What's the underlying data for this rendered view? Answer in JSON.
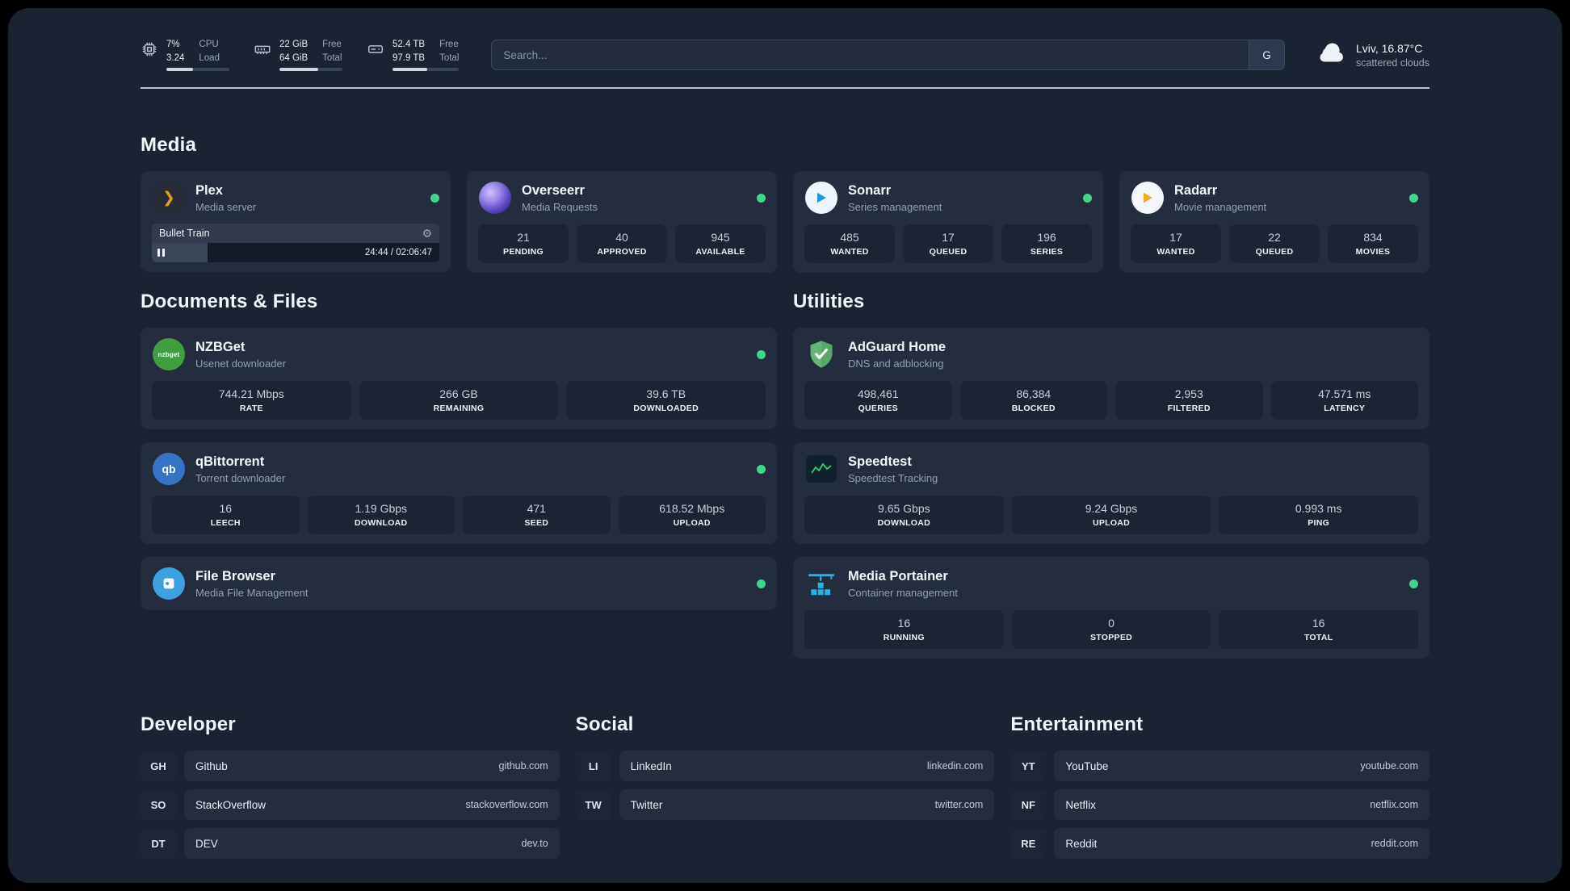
{
  "colors": {
    "background": "#1a2332",
    "card": "#232d3e",
    "stat_tile": "#1b2433",
    "status_online": "#3fd58b",
    "plex_accent": "#e5a00d",
    "divider": "#ccd4df"
  },
  "icons": {
    "gear": "⚙",
    "plex_glyph": "❯",
    "nzbget_icon_text": "nzbget",
    "qbittorrent_icon_text": "qb"
  },
  "topbar": {
    "resources": [
      {
        "id": "cpu",
        "line1": "7%",
        "line2": "3.24",
        "label1": "CPU",
        "label2": "Load",
        "progress_pct": 42
      },
      {
        "id": "memory",
        "line1": "22 GiB",
        "line2": "64 GiB",
        "label1": "Free",
        "label2": "Total",
        "progress_pct": 62
      },
      {
        "id": "disk",
        "line1": "52.4 TB",
        "line2": "97.9 TB",
        "label1": "Free",
        "label2": "Total",
        "progress_pct": 52
      }
    ],
    "search": {
      "placeholder": "Search...",
      "provider_label": "G"
    },
    "weather": {
      "title": "Lviv, 16.87°C",
      "description": "scattered clouds"
    }
  },
  "media": {
    "title": "Media",
    "plex": {
      "name": "Plex",
      "description": "Media server",
      "player": {
        "track": "Bullet Train",
        "time": "24:44 / 02:06:47",
        "progress_pct": 19.5
      }
    },
    "overseerr": {
      "name": "Overseerr",
      "description": "Media Requests",
      "stats": [
        {
          "value": "21",
          "label": "PENDING"
        },
        {
          "value": "40",
          "label": "APPROVED"
        },
        {
          "value": "945",
          "label": "AVAILABLE"
        }
      ]
    },
    "sonarr": {
      "name": "Sonarr",
      "description": "Series management",
      "stats": [
        {
          "value": "485",
          "label": "WANTED"
        },
        {
          "value": "17",
          "label": "QUEUED"
        },
        {
          "value": "196",
          "label": "SERIES"
        }
      ]
    },
    "radarr": {
      "name": "Radarr",
      "description": "Movie management",
      "stats": [
        {
          "value": "17",
          "label": "WANTED"
        },
        {
          "value": "22",
          "label": "QUEUED"
        },
        {
          "value": "834",
          "label": "MOVIES"
        }
      ]
    }
  },
  "documents": {
    "title": "Documents & Files",
    "nzbget": {
      "name": "NZBGet",
      "description": "Usenet downloader",
      "stats": [
        {
          "value": "744.21 Mbps",
          "label": "RATE"
        },
        {
          "value": "266 GB",
          "label": "REMAINING"
        },
        {
          "value": "39.6 TB",
          "label": "DOWNLOADED"
        }
      ]
    },
    "qbittorrent": {
      "name": "qBittorrent",
      "description": "Torrent downloader",
      "stats": [
        {
          "value": "16",
          "label": "LEECH"
        },
        {
          "value": "1.19 Gbps",
          "label": "DOWNLOAD"
        },
        {
          "value": "471",
          "label": "SEED"
        },
        {
          "value": "618.52 Mbps",
          "label": "UPLOAD"
        }
      ]
    },
    "filebrowser": {
      "name": "File Browser",
      "description": "Media File Management"
    }
  },
  "utilities": {
    "title": "Utilities",
    "adguard": {
      "name": "AdGuard Home",
      "description": "DNS and adblocking",
      "stats": [
        {
          "value": "498,461",
          "label": "QUERIES"
        },
        {
          "value": "86,384",
          "label": "BLOCKED"
        },
        {
          "value": "2,953",
          "label": "FILTERED"
        },
        {
          "value": "47.571 ms",
          "label": "LATENCY"
        }
      ]
    },
    "speedtest": {
      "name": "Speedtest",
      "description": "Speedtest Tracking",
      "stats": [
        {
          "value": "9.65 Gbps",
          "label": "DOWNLOAD"
        },
        {
          "value": "9.24 Gbps",
          "label": "UPLOAD"
        },
        {
          "value": "0.993 ms",
          "label": "PING"
        }
      ]
    },
    "portainer": {
      "name": "Media Portainer",
      "description": "Container management",
      "stats": [
        {
          "value": "16",
          "label": "RUNNING"
        },
        {
          "value": "0",
          "label": "STOPPED"
        },
        {
          "value": "16",
          "label": "TOTAL"
        }
      ]
    }
  },
  "bookmarks": {
    "developer": {
      "title": "Developer",
      "items": [
        {
          "abbr": "GH",
          "name": "Github",
          "domain": "github.com"
        },
        {
          "abbr": "SO",
          "name": "StackOverflow",
          "domain": "stackoverflow.com"
        },
        {
          "abbr": "DT",
          "name": "DEV",
          "domain": "dev.to"
        }
      ]
    },
    "social": {
      "title": "Social",
      "items": [
        {
          "abbr": "LI",
          "name": "LinkedIn",
          "domain": "linkedin.com"
        },
        {
          "abbr": "TW",
          "name": "Twitter",
          "domain": "twitter.com"
        }
      ]
    },
    "entertainment": {
      "title": "Entertainment",
      "items": [
        {
          "abbr": "YT",
          "name": "YouTube",
          "domain": "youtube.com"
        },
        {
          "abbr": "NF",
          "name": "Netflix",
          "domain": "netflix.com"
        },
        {
          "abbr": "RE",
          "name": "Reddit",
          "domain": "reddit.com"
        }
      ]
    }
  }
}
